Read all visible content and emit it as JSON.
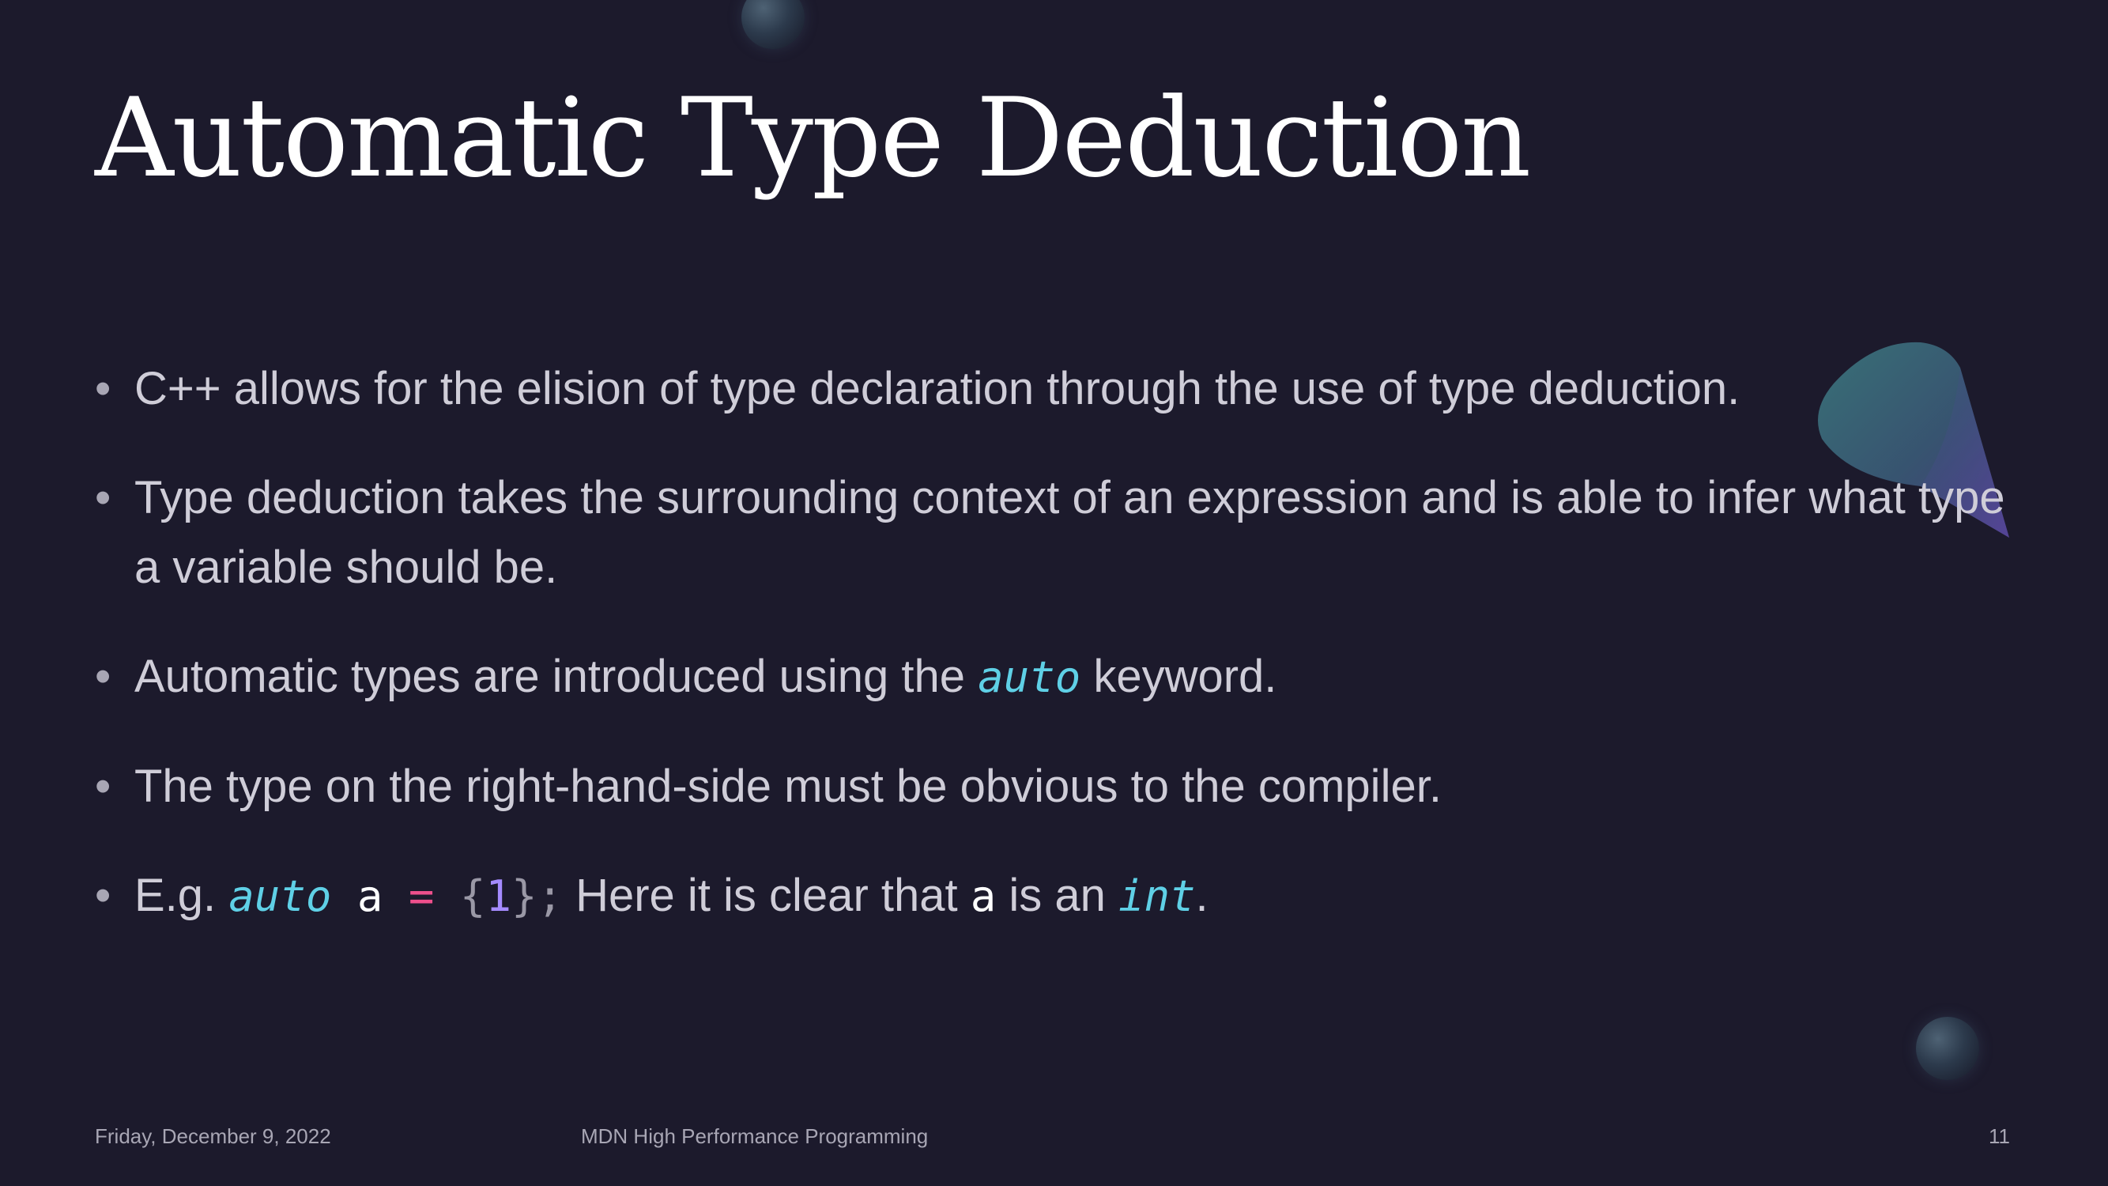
{
  "slide": {
    "title": "Automatic Type Deduction",
    "bullets": [
      {
        "text": "C++ allows for the elision of type declaration through the use of type deduction."
      },
      {
        "text": "Type deduction takes the surrounding context of an expression and is able to infer what type a variable should be."
      },
      {
        "before": "Automatic types are introduced using the ",
        "code": "auto",
        "after": " keyword."
      },
      {
        "text": "The type on the right-hand-side must be obvious to the compiler."
      },
      {
        "lead": "E.g. ",
        "code_kw": "auto",
        "code_var": "a",
        "code_op": "=",
        "code_open": "{",
        "code_num": "1",
        "code_close": "};",
        "middle": " Here it is clear that ",
        "code_var2": "a",
        "middle2": " is an ",
        "code_type": "int",
        "tail": "."
      }
    ],
    "bullet_symbol": "•"
  },
  "footer": {
    "date": "Friday, December 9, 2022",
    "center": "MDN High Performance Programming",
    "page_number": "11"
  },
  "colors": {
    "background": "#1c1a2c",
    "title": "#ffffff",
    "body_text": "#cfcdd8",
    "code_keyword": "#5fd0e6",
    "code_operator": "#ee4f8c",
    "code_number": "#a58bff"
  },
  "decorations": [
    "sphere-top",
    "cone-shape",
    "sphere-bottom"
  ]
}
